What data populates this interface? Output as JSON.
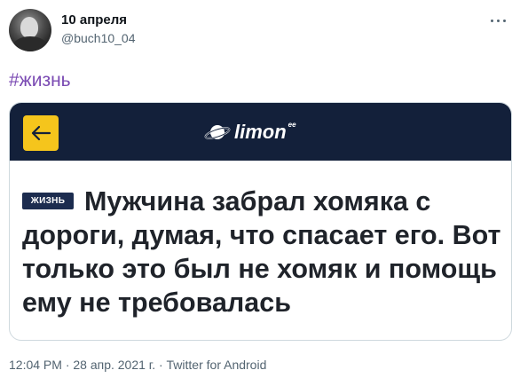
{
  "tweet": {
    "date": "10 апреля",
    "handle": "@buch10_04",
    "hashtag": "#жизнь",
    "timestamp": "12:04 PM · 28 апр. 2021 г. · ",
    "source": "Twitter for Android"
  },
  "card": {
    "logo_text": "limon",
    "logo_sup": "ee",
    "badge": "ЖИЗНЬ",
    "headline": "Мужчина забрал хомяка с дороги, думая, что спасает его. Вот только это был не хомяк и помощь ему не требовалась"
  },
  "colors": {
    "hashtag": "#7b4bb3",
    "card_header_bg": "#13203a",
    "back_button_bg": "#f5c51c",
    "badge_bg": "#1c2c4f",
    "meta_text": "#536471"
  },
  "icons": {
    "more": "more-icon",
    "back": "arrow-left-icon",
    "logo": "planet-logo-icon"
  }
}
